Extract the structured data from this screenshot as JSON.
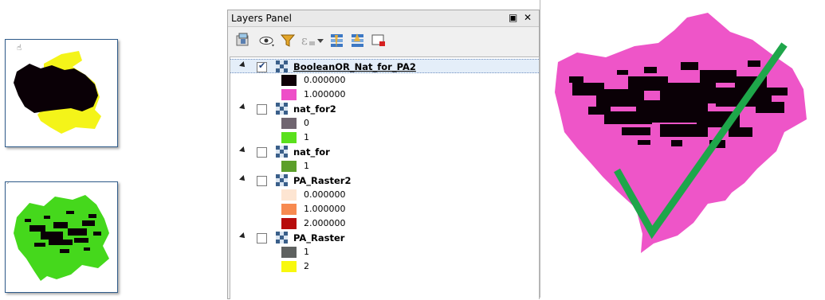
{
  "panel": {
    "title": "Layers Panel"
  },
  "colors": {
    "pink": "#ee55c8",
    "black": "#0a0006",
    "yellow": "#f4f419",
    "green": "#45d81c",
    "check_green": "#1ea64a"
  },
  "layers": [
    {
      "name": "BooleanOR_Nat_for_PA2",
      "checked": true,
      "selected": true,
      "legend": [
        {
          "color": "#0e0006",
          "label": "0.000000"
        },
        {
          "color": "#ee4fc8",
          "label": "1.000000"
        }
      ]
    },
    {
      "name": "nat_for2",
      "checked": false,
      "legend": [
        {
          "color": "#706570",
          "label": "0"
        },
        {
          "color": "#5ae01c",
          "label": "1"
        }
      ]
    },
    {
      "name": "nat_for",
      "checked": false,
      "legend": [
        {
          "color": "#5c9f2a",
          "label": "1"
        }
      ]
    },
    {
      "name": "PA_Raster2",
      "checked": false,
      "legend": [
        {
          "color": "#fde5d2",
          "label": "0.000000"
        },
        {
          "color": "#f78a50",
          "label": "1.000000"
        },
        {
          "color": "#b70c0c",
          "label": "2.000000"
        }
      ]
    },
    {
      "name": "PA_Raster",
      "checked": false,
      "legend": [
        {
          "color": "#5e6160",
          "label": "1"
        },
        {
          "color": "#f8f80e",
          "label": "2"
        }
      ]
    }
  ],
  "icons": {
    "toolbar": [
      "add-group-icon",
      "visibility-icon",
      "filter-icon",
      "expression-filter-icon",
      "dropdown-icon",
      "expand-all-icon",
      "collapse-all-icon",
      "remove-layer-icon"
    ],
    "title_buttons": [
      "float-icon",
      "close-icon"
    ]
  }
}
